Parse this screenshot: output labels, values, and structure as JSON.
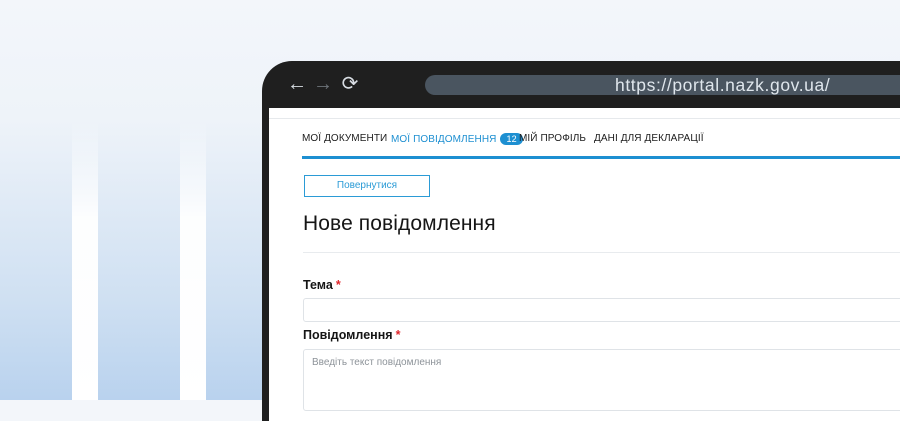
{
  "browser": {
    "url": "https://portal.nazk.gov.ua/",
    "back_icon": "←",
    "forward_icon": "→",
    "reload_icon": "⟳"
  },
  "tabs": [
    {
      "label": "МОЇ ДОКУМЕНТИ"
    },
    {
      "label": "МОЇ ПОВІДОМЛЕННЯ",
      "badge": "12",
      "active": true
    },
    {
      "label": "МІЙ ПРОФІЛЬ"
    },
    {
      "label": "ДАНІ ДЛЯ ДЕКЛАРАЦІЇ"
    }
  ],
  "actions": {
    "back_label": "Повернутися"
  },
  "page": {
    "title": "Нове повідомлення"
  },
  "form": {
    "topic_label": "Тема",
    "topic_value": "",
    "message_label": "Повідомлення",
    "message_placeholder": "Введіть текст повідомлення",
    "required_mark": "*"
  },
  "colors": {
    "accent": "#1d8fd1",
    "required": "#e0262b",
    "frame": "#1f1f1f"
  }
}
